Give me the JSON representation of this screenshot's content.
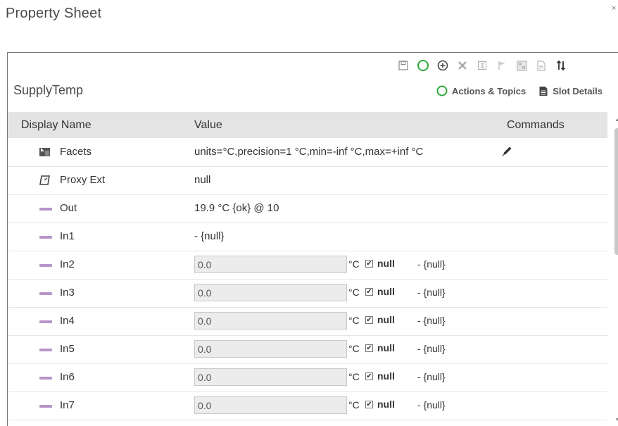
{
  "page": {
    "title": "Property Sheet",
    "corner_glyph": "×"
  },
  "component": {
    "name": "SupplyTemp"
  },
  "toolbar": {
    "icons": [
      "save-icon",
      "action-circle-icon",
      "add-icon",
      "delete-icon",
      "slot-sheet-icon",
      "flag-icon",
      "image-icon",
      "doc-icon",
      "sort-icon"
    ]
  },
  "view_links": {
    "actions_topics": "Actions & Topics",
    "slot_details": "Slot Details"
  },
  "columns": {
    "display_name": "Display Name",
    "value": "Value",
    "commands": "Commands"
  },
  "rows": [
    {
      "name": "Facets",
      "icon": "facets-icon",
      "value": "units=°C,precision=1 °C,min=-inf °C,max=+inf °C",
      "has_edit": true
    },
    {
      "name": "Proxy Ext",
      "icon": "proxy-ext-icon",
      "value": "null"
    },
    {
      "name": "Out",
      "icon": "slot-dash-icon",
      "value": "19.9 °C {ok} @ 10"
    },
    {
      "name": "In1",
      "icon": "slot-dash-icon",
      "value": "- {null}"
    },
    {
      "name": "In2",
      "icon": "slot-dash-icon",
      "input": "0.0",
      "unit": "°C",
      "null_label": "null",
      "status": "- {null}"
    },
    {
      "name": "In3",
      "icon": "slot-dash-icon",
      "input": "0.0",
      "unit": "°C",
      "null_label": "null",
      "status": "- {null}"
    },
    {
      "name": "In4",
      "icon": "slot-dash-icon",
      "input": "0.0",
      "unit": "°C",
      "null_label": "null",
      "status": "- {null}"
    },
    {
      "name": "In5",
      "icon": "slot-dash-icon",
      "input": "0.0",
      "unit": "°C",
      "null_label": "null",
      "status": "- {null}"
    },
    {
      "name": "In6",
      "icon": "slot-dash-icon",
      "input": "0.0",
      "unit": "°C",
      "null_label": "null",
      "status": "- {null}"
    },
    {
      "name": "In7",
      "icon": "slot-dash-icon",
      "input": "0.0",
      "unit": "°C",
      "null_label": "null",
      "status": "- {null}"
    }
  ],
  "colors": {
    "accent_green": "#2eaa3a",
    "slot_purple": "#b794c9",
    "header_bg": "#e4e4e4"
  }
}
